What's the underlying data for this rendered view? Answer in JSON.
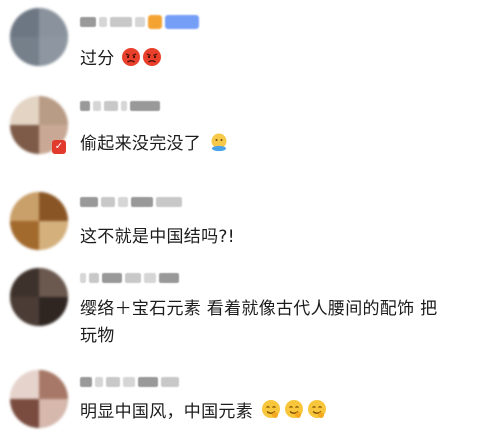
{
  "comments": [
    {
      "text": "过分"
    },
    {
      "text": "偷起来没完没了"
    },
    {
      "text": "这不就是中国结吗?!"
    },
    {
      "line1": "缨络＋宝石元素 看着就像古代人腰间的配饰 把",
      "line2": "玩物"
    },
    {
      "text": "明显中国风，中国元素"
    }
  ],
  "emojis": [
    "angry-face-icon",
    "thinking-face-icon",
    "smiling-face-icon"
  ]
}
